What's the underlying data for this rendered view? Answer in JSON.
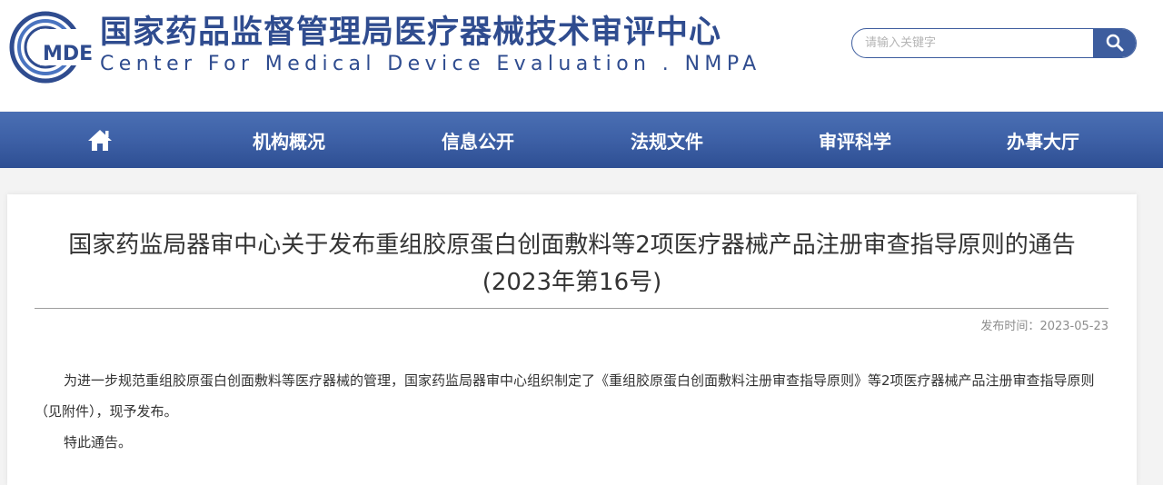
{
  "header": {
    "logo_text": "MDE",
    "org_name_cn": "国家药品监督管理局医疗器械技术审评中心",
    "org_name_en": "Center For Medical Device Evaluation . NMPA",
    "search": {
      "placeholder": "请输入关键字",
      "value": "",
      "button_icon": "search-icon"
    }
  },
  "nav": {
    "home_icon": "home-icon",
    "items": [
      {
        "label": "机构概况"
      },
      {
        "label": "信息公开"
      },
      {
        "label": "法规文件"
      },
      {
        "label": "审评科学"
      },
      {
        "label": "办事大厅"
      }
    ]
  },
  "article": {
    "title": "国家药监局器审中心关于发布重组胶原蛋白创面敷料等2项医疗器械产品注册审查指导原则的通告",
    "subtitle": "(2023年第16号)",
    "publish_label": "发布时间：",
    "publish_date": "2023-05-23",
    "paragraphs": [
      "为进一步规范重组胶原蛋白创面敷料等医疗器械的管理，国家药监局器审中心组织制定了《重组胶原蛋白创面敷料注册审查指导原则》等2项医疗器械产品注册审查指导原则（见附件），现予发布。",
      "特此通告。"
    ]
  },
  "colors": {
    "brand_blue": "#2f4c8f",
    "nav_blue": "#3e61a7",
    "page_bg": "#f3f3f3"
  }
}
